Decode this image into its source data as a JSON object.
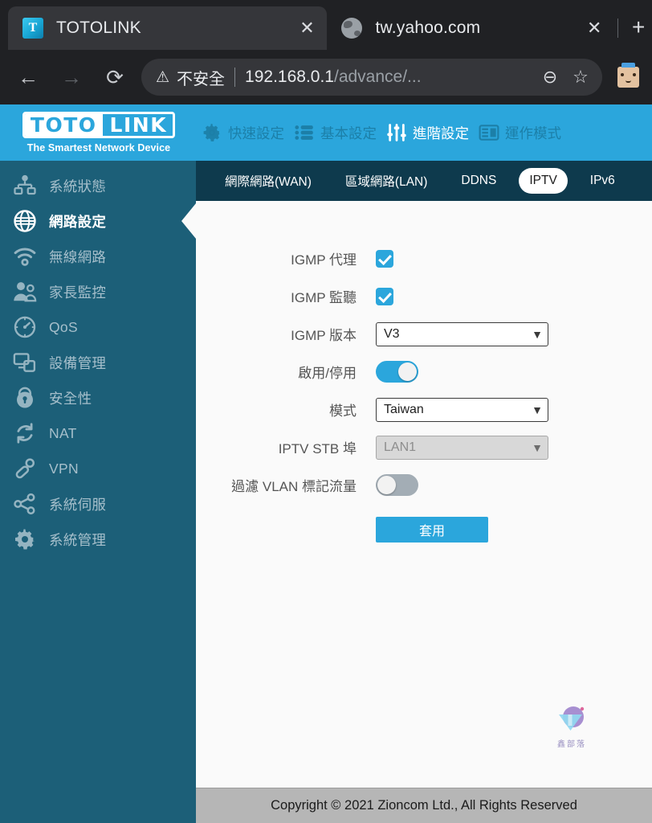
{
  "browser": {
    "tabs": [
      {
        "title": "TOTOLINK",
        "favicon": "totolink-favicon",
        "close_label": "✕",
        "active": true
      },
      {
        "title": "tw.yahoo.com",
        "favicon": "globe-icon",
        "close_label": "✕",
        "active": false
      }
    ],
    "new_tab_label": "+",
    "back_label": "←",
    "forward_label": "→",
    "reload_label": "⟳",
    "omnibox": {
      "warning_icon": "⚠",
      "security_text": "不安全",
      "divider": "|",
      "url_host": "192.168.0.1",
      "url_path": "/advance/...",
      "zoom_icon": "⊖",
      "bookmark_icon": "☆"
    },
    "avatar_name": "profile-avatar"
  },
  "brand": {
    "logo_left": "TOTO",
    "logo_right": "LINK",
    "tagline": "The Smartest Network Device",
    "accent_color": "#2ba6dc",
    "topnav": [
      {
        "label": "快速設定",
        "icon": "gear-icon",
        "active": false
      },
      {
        "label": "基本設定",
        "icon": "list-icon",
        "active": false
      },
      {
        "label": "進階設定",
        "icon": "sliders-icon",
        "active": true
      },
      {
        "label": "運作模式",
        "icon": "window-icon",
        "active": false
      }
    ]
  },
  "sidebar": {
    "items": [
      {
        "label": "系統狀態",
        "icon": "network-status-icon",
        "active": false
      },
      {
        "label": "網路設定",
        "icon": "globe-icon",
        "active": true
      },
      {
        "label": "無線網路",
        "icon": "wifi-icon",
        "active": false
      },
      {
        "label": "家長監控",
        "icon": "parental-control-icon",
        "active": false
      },
      {
        "label": "QoS",
        "icon": "speedometer-icon",
        "active": false
      },
      {
        "label": "設備管理",
        "icon": "devices-icon",
        "active": false
      },
      {
        "label": "安全性",
        "icon": "lock-icon",
        "active": false
      },
      {
        "label": "NAT",
        "icon": "refresh-icon",
        "active": false
      },
      {
        "label": "VPN",
        "icon": "key-icon",
        "active": false
      },
      {
        "label": "系統伺服",
        "icon": "share-icon",
        "active": false
      },
      {
        "label": "系統管理",
        "icon": "gear-icon",
        "active": false
      }
    ]
  },
  "subtabs": [
    {
      "label": "網際網路(WAN)",
      "active": false
    },
    {
      "label": "區域網路(LAN)",
      "active": false
    },
    {
      "label": "DDNS",
      "active": false
    },
    {
      "label": "IPTV",
      "active": true
    },
    {
      "label": "IPv6",
      "active": false
    }
  ],
  "form": {
    "rows": [
      {
        "label": "IGMP 代理",
        "type": "checkbox",
        "checked": true
      },
      {
        "label": "IGMP 監聽",
        "type": "checkbox",
        "checked": true
      },
      {
        "label": "IGMP 版本",
        "type": "select",
        "value": "V3",
        "disabled": false,
        "arrow": "▼"
      },
      {
        "label": "啟用/停用",
        "type": "toggle",
        "on": true
      },
      {
        "label": "模式",
        "type": "select",
        "value": "Taiwan",
        "disabled": false,
        "arrow": "▼"
      },
      {
        "label": "IPTV STB 埠",
        "type": "select",
        "value": "LAN1",
        "disabled": true,
        "arrow": "▼"
      },
      {
        "label": "過濾 VLAN 標記流量",
        "type": "toggle",
        "on": false
      }
    ],
    "apply_label": "套用"
  },
  "watermark": {
    "text": "鑫部落"
  },
  "footer": {
    "copyright": "Copyright © 2021 Zioncom Ltd., All Rights Reserved"
  }
}
